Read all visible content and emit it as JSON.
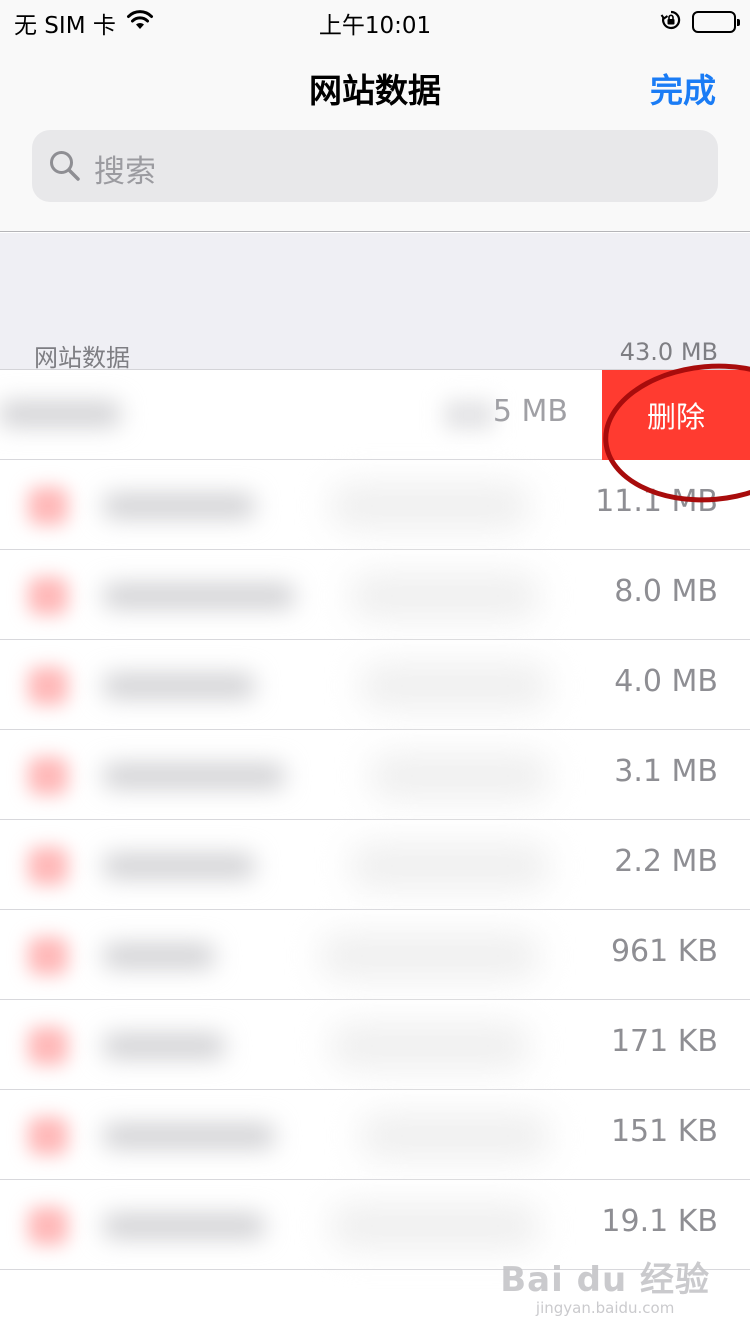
{
  "status_bar": {
    "carrier": "无 SIM 卡",
    "time": "上午10:01"
  },
  "nav": {
    "title": "网站数据",
    "done_label": "完成"
  },
  "search": {
    "placeholder": "搜索"
  },
  "section": {
    "title": "网站数据",
    "total": "43.0 MB"
  },
  "swiped_row": {
    "size": "5 MB",
    "delete_label": "删除"
  },
  "rows": [
    {
      "size": "11.1 MB"
    },
    {
      "size": "8.0 MB"
    },
    {
      "size": "4.0 MB"
    },
    {
      "size": "3.1 MB"
    },
    {
      "size": "2.2 MB"
    },
    {
      "size": "961 KB"
    },
    {
      "size": "171 KB"
    },
    {
      "size": "151 KB"
    },
    {
      "size": "19.1 KB"
    }
  ],
  "watermark": {
    "logo": "Bai du 经验",
    "url": "jingyan.baidu.com"
  },
  "colors": {
    "accent": "#1a7cf5",
    "delete": "#ff3b30",
    "annotation": "#a80c0c"
  },
  "icons": [
    "wifi-icon",
    "orientation-lock-icon",
    "battery-icon",
    "search-icon"
  ]
}
